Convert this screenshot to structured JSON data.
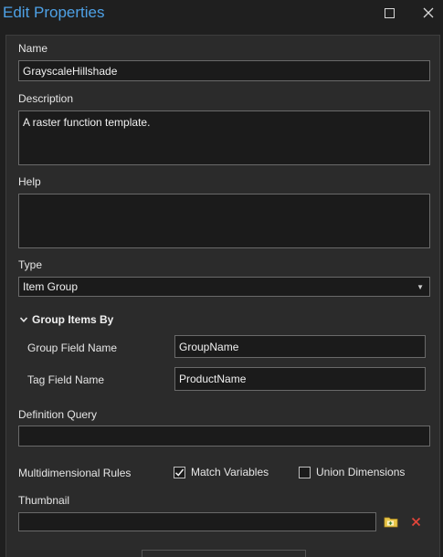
{
  "window": {
    "title": "Edit Properties"
  },
  "form": {
    "name_label": "Name",
    "name_value": "GrayscaleHillshade",
    "description_label": "Description",
    "description_value": "A raster function template.",
    "help_label": "Help",
    "help_value": "",
    "type_label": "Type",
    "type_value": "Item Group",
    "group_section_title": "Group Items By",
    "group_field_label": "Group Field Name",
    "group_field_value": "GroupName",
    "tag_field_label": "Tag Field Name",
    "tag_field_value": "ProductName",
    "definition_query_label": "Definition Query",
    "definition_query_value": "",
    "multidimensional_label": "Multidimensional Rules",
    "match_variables_label": "Match Variables",
    "match_variables_checked": true,
    "union_dimensions_label": "Union Dimensions",
    "union_dimensions_checked": false,
    "thumbnail_label": "Thumbnail",
    "thumbnail_value": ""
  },
  "colors": {
    "title_blue": "#4ea1e6",
    "clear_red": "#e0453a",
    "browse_yellow": "#e8c64a"
  }
}
